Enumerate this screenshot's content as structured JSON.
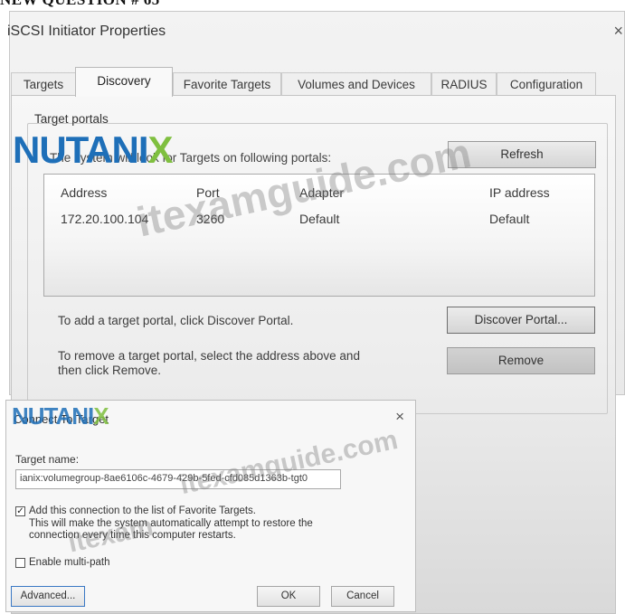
{
  "header": "NEW QUESTION # 65",
  "dialog1": {
    "title": "iSCSI Initiator Properties",
    "close": "×",
    "tabs": [
      "Targets",
      "Discovery",
      "Favorite Targets",
      "Volumes and Devices",
      "RADIUS",
      "Configuration"
    ],
    "active_tab": "Discovery",
    "group_label": "Target portals",
    "intro": "The system will look for Targets on following portals:",
    "refresh_label": "Refresh",
    "columns": [
      "Address",
      "Port",
      "Adapter",
      "IP address"
    ],
    "rows": [
      [
        "172.20.100.104",
        "3260",
        "Default",
        "Default"
      ]
    ],
    "discover_note": "To add a target portal, click Discover Portal.",
    "discover_label": "Discover Portal...",
    "remove_note_1": "To remove a target portal, select the address above and",
    "remove_note_2": "then click Remove.",
    "remove_label": "Remove"
  },
  "dialog2": {
    "title": "Connect To Target",
    "close": "×",
    "target_name_label": "Target name:",
    "target_name_value": "ianix:volumegroup-8ae6106c-4679-429b-5fed-cfd085d1363b-tgt0",
    "favorite_checked": true,
    "favorite_label": "Add this connection to the list of Favorite Targets.",
    "favorite_desc_1": "This will make the system automatically attempt to restore the",
    "favorite_desc_2": "connection every time this computer restarts.",
    "multipath_checked": false,
    "multipath_label": "Enable multi-path",
    "advanced_label": "Advanced...",
    "ok_label": "OK",
    "cancel_label": "Cancel"
  },
  "watermarks": {
    "brand": "NUTANI",
    "brand_x": "X",
    "site1": "itexamguide.com",
    "site2": "itexamguide.com",
    "site3": "itexam"
  },
  "colors": {
    "brand_blue": "#1e6fb8",
    "brand_green": "#7fbf3f"
  }
}
